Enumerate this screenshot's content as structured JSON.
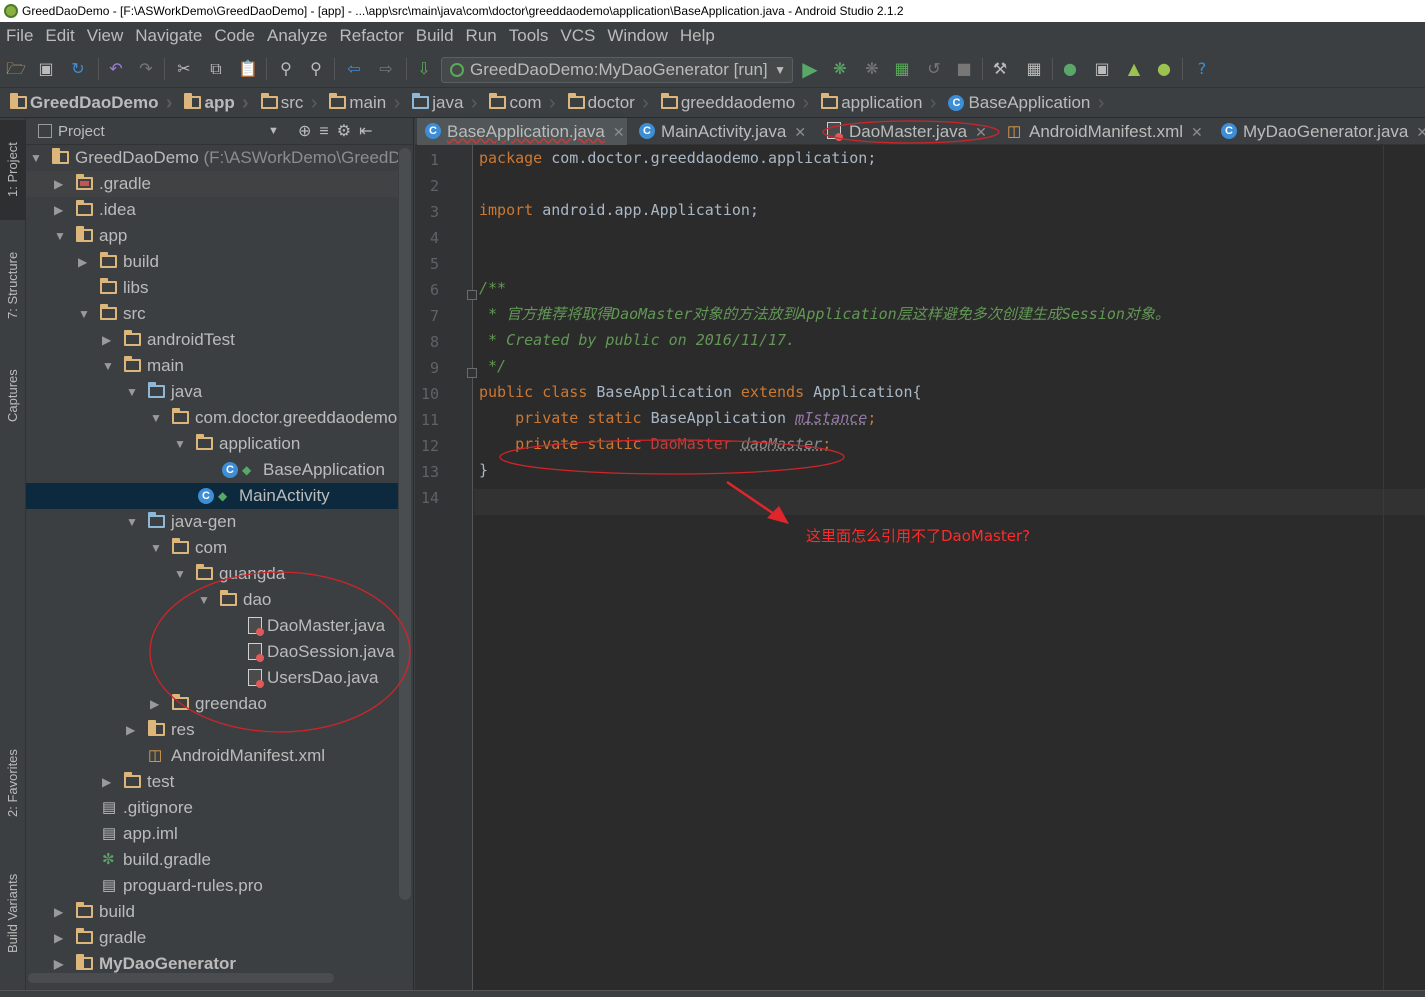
{
  "window": {
    "title": "GreedDaoDemo - [F:\\ASWorkDemo\\GreedDaoDemo] - [app] - ...\\app\\src\\main\\java\\com\\doctor\\greeddaodemo\\application\\BaseApplication.java - Android Studio 2.1.2"
  },
  "menu": [
    "File",
    "Edit",
    "View",
    "Navigate",
    "Code",
    "Analyze",
    "Refactor",
    "Build",
    "Run",
    "Tools",
    "VCS",
    "Window",
    "Help"
  ],
  "run_config": "GreedDaoDemo:MyDaoGenerator [run]",
  "breadcrumbs": [
    "GreedDaoDemo",
    "app",
    "src",
    "main",
    "java",
    "com",
    "doctor",
    "greeddaodemo",
    "application",
    "BaseApplication"
  ],
  "side_tabs": {
    "project": "1: Project",
    "structure": "7: Structure",
    "captures": "Captures",
    "favorites": "2: Favorites",
    "build_variants": "Build Variants"
  },
  "project_panel": {
    "title": "Project",
    "tree": [
      {
        "label": "GreedDaoDemo",
        "extra": "(F:\\ASWorkDemo\\GreedD"
      },
      {
        "label": ".gradle"
      },
      {
        "label": ".idea"
      },
      {
        "label": "app"
      },
      {
        "label": "build"
      },
      {
        "label": "libs"
      },
      {
        "label": "src"
      },
      {
        "label": "androidTest"
      },
      {
        "label": "main"
      },
      {
        "label": "java"
      },
      {
        "label": "com.doctor.greeddaodemo"
      },
      {
        "label": "application"
      },
      {
        "label": "BaseApplication"
      },
      {
        "label": "MainActivity"
      },
      {
        "label": "java-gen"
      },
      {
        "label": "com"
      },
      {
        "label": "guangda"
      },
      {
        "label": "dao"
      },
      {
        "label": "DaoMaster.java"
      },
      {
        "label": "DaoSession.java"
      },
      {
        "label": "UsersDao.java"
      },
      {
        "label": "greendao"
      },
      {
        "label": "res"
      },
      {
        "label": "AndroidManifest.xml"
      },
      {
        "label": "test"
      },
      {
        "label": ".gitignore"
      },
      {
        "label": "app.iml"
      },
      {
        "label": "build.gradle"
      },
      {
        "label": "proguard-rules.pro"
      },
      {
        "label": "build"
      },
      {
        "label": "gradle"
      },
      {
        "label": "MyDaoGenerator"
      }
    ]
  },
  "editor": {
    "tabs": [
      "BaseApplication.java",
      "MainActivity.java",
      "DaoMaster.java",
      "AndroidManifest.xml",
      "MyDaoGenerator.java"
    ],
    "line_numbers": [
      "1",
      "2",
      "3",
      "4",
      "5",
      "6",
      "7",
      "8",
      "9",
      "10",
      "11",
      "12",
      "13",
      "14"
    ],
    "code": {
      "l1_kw": "package",
      "l1_rest": " com.doctor.greeddaodemo.application;",
      "l3_kw": "import",
      "l3_rest": " android.app.Application;",
      "l6": "/**",
      "l7": " * 官方推荐将取得DaoMaster对象的方法放到Application层这样避免多次创建生成Session对象。",
      "l8": " * Created by public on 2016/11/17.",
      "l9": " */",
      "l10_kw1": "public class",
      "l10_name": " BaseApplication ",
      "l10_kw2": "extends",
      "l10_rest": " Application{",
      "l11_kw": "    private static",
      "l11_type": " BaseApplication ",
      "l11_field": "mIstance",
      "l11_end": ";",
      "l12_kw": "    private static",
      "l12_type": " DaoMaster ",
      "l12_field": "daoMaster",
      "l12_end": ";",
      "l13": "}"
    }
  },
  "annotation": "这里面怎么引用不了DaoMaster?",
  "colors": {
    "annotation_red": "#ff2b2b",
    "keyword": "#cc7832",
    "comment": "#629755",
    "field": "#9876aa",
    "error": "#bc3f3c"
  }
}
